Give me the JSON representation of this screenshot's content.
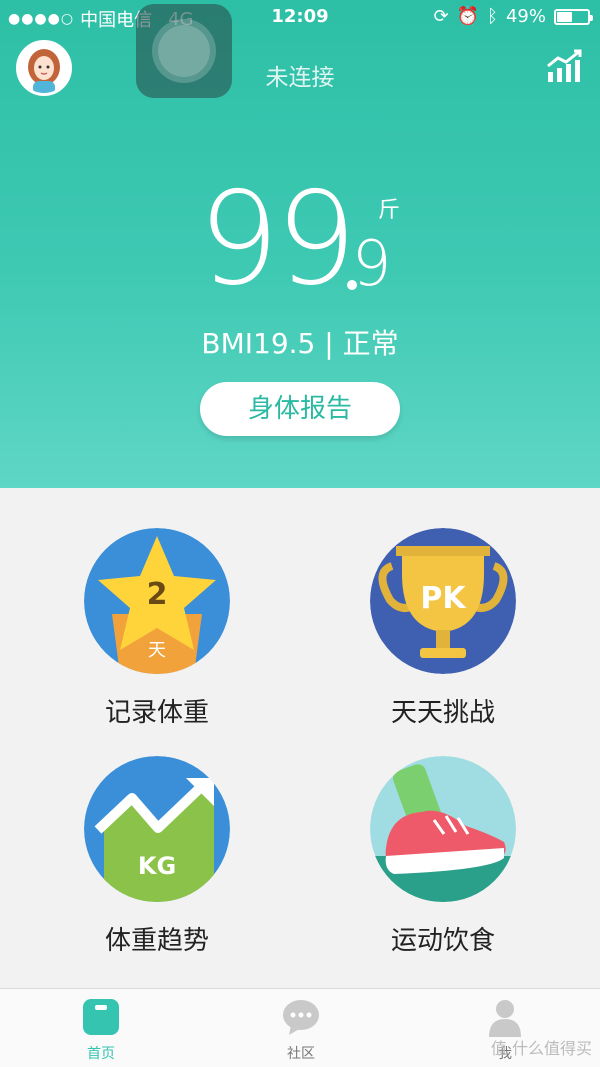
{
  "status": {
    "carrier": "中国电信",
    "network": "4G",
    "time": "12:09",
    "battery": "49%",
    "battery_level": 0.49
  },
  "header": {
    "connection": "未连接"
  },
  "weight": {
    "integer": "99",
    "decimal": "9",
    "unit": "斤",
    "bmi_text": "BMI19.5 | 正常"
  },
  "report_button": "身体报告",
  "tiles": [
    {
      "label": "记录体重",
      "badge": "2",
      "sub": "天"
    },
    {
      "label": "天天挑战",
      "badge": "PK"
    },
    {
      "label": "体重趋势",
      "badge": "KG"
    },
    {
      "label": "运动饮食"
    }
  ],
  "tabs": [
    {
      "label": "首页",
      "icon": "scale-icon"
    },
    {
      "label": "社区",
      "icon": "chat-bubble-icon"
    },
    {
      "label": "我",
      "icon": "person-icon"
    }
  ],
  "watermark": "值 什么值得买",
  "colors": {
    "primary": "#2dbfa6",
    "active_tab": "#35c4b0"
  }
}
